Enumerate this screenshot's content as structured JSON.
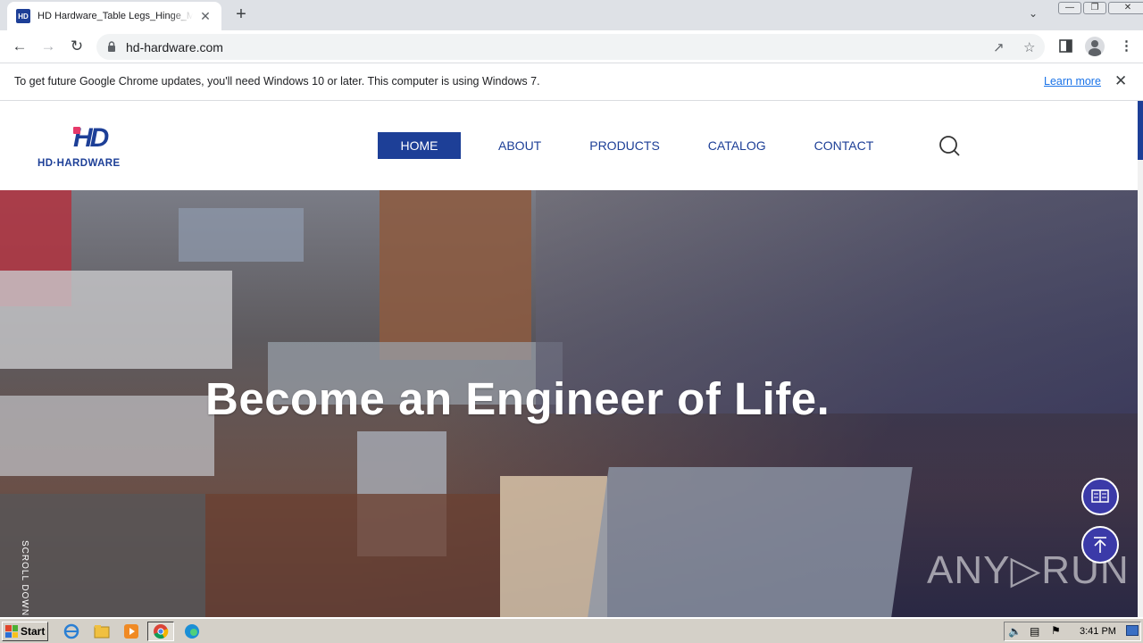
{
  "browser": {
    "tab": {
      "favicon_text": "HD",
      "title": "HD Hardware_Table Legs_Hinge_Metal",
      "close": "✕"
    },
    "new_tab": "+",
    "url": "hd-hardware.com",
    "window_controls": [
      "—",
      "❐",
      "✕"
    ],
    "infobar": {
      "message": "To get future Google Chrome updates, you'll need Windows 10 or later. This computer is using Windows 7.",
      "link": "Learn more",
      "close": "✕"
    }
  },
  "site": {
    "logo": {
      "mark": "HD",
      "text": "HD·HARDWARE"
    },
    "nav": [
      {
        "label": "HOME",
        "active": true
      },
      {
        "label": "ABOUT",
        "active": false
      },
      {
        "label": "PRODUCTS",
        "active": false
      },
      {
        "label": "CATALOG",
        "active": false
      },
      {
        "label": "CONTACT",
        "active": false
      }
    ],
    "hero": {
      "title": "Become an Engineer of Life.",
      "scroll_hint": "SCROLL DOWN"
    },
    "watermark": "ANY▷RUN",
    "colors": {
      "brand": "#1d3f97",
      "accent": "#e63a6a",
      "fab": "#3b3aa8"
    }
  },
  "taskbar": {
    "start_label": "Start",
    "apps": [
      "ie-icon",
      "explorer-icon",
      "media-player-icon",
      "chrome-icon",
      "edge-icon"
    ],
    "clock": "3:41 PM"
  }
}
